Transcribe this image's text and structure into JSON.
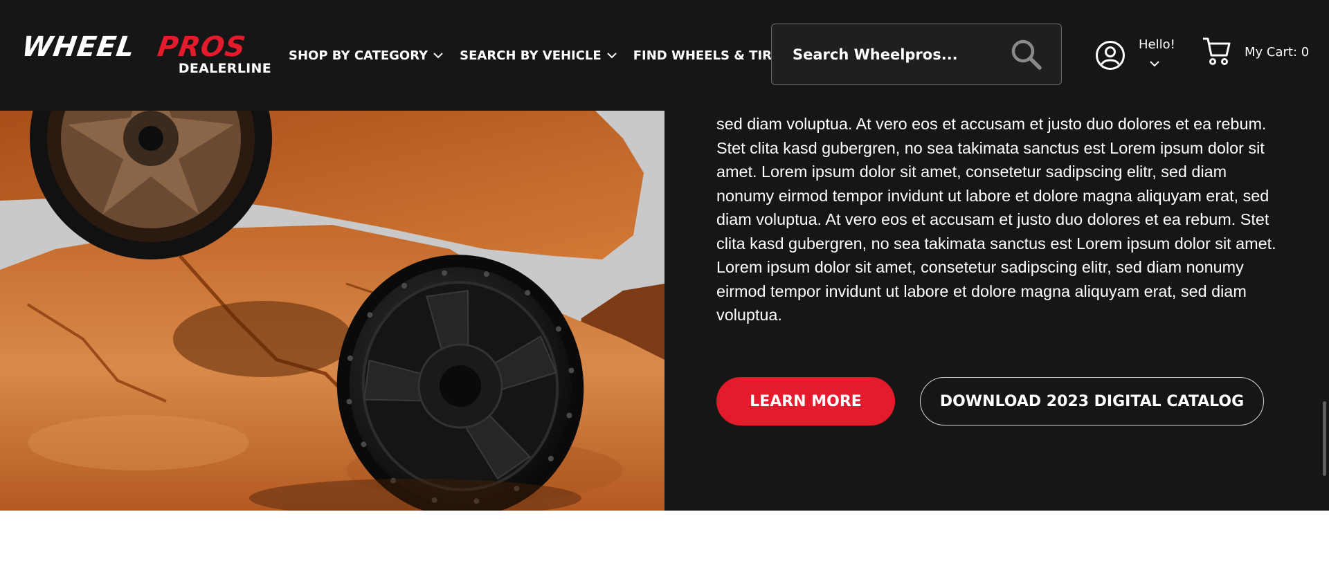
{
  "brand": {
    "word1": "WHEEL",
    "word2": "PROS",
    "sub": "DEALERLINE",
    "accent": "#e31b2c"
  },
  "nav": {
    "items": [
      {
        "label": "SHOP BY CATEGORY",
        "has_dropdown": true
      },
      {
        "label": "SEARCH BY VEHICLE",
        "has_dropdown": true
      },
      {
        "label": "FIND WHEELS & TIRES",
        "has_dropdown": false
      }
    ]
  },
  "search": {
    "placeholder": "Search Wheelpros...",
    "icon": "search-icon"
  },
  "account": {
    "greeting": "Hello!",
    "icon": "user-circle-icon"
  },
  "cart": {
    "label": "My Cart: 0",
    "icon": "shopping-cart-icon"
  },
  "hero": {
    "image_alt": "black off-road wheel on red rock",
    "body": "sed diam voluptua. At vero eos et accusam et justo duo dolores et ea rebum. Stet clita kasd gubergren, no sea takimata sanctus est Lorem ipsum dolor sit amet. Lorem ipsum dolor sit amet, consetetur sadipscing elitr, sed diam nonumy eirmod tempor invidunt ut labore et dolore magna aliquyam erat, sed diam voluptua. At vero eos et accusam et justo duo dolores et ea rebum. Stet clita kasd gubergren, no sea takimata sanctus est Lorem ipsum dolor sit amet. Lorem ipsum dolor sit amet, consetetur sadipscing elitr, sed diam nonumy eirmod tempor invidunt ut labore et dolore magna aliquyam erat, sed diam voluptua.",
    "learn_more": "LEARN MORE",
    "catalog": "DOWNLOAD 2023 DIGITAL CATALOG"
  },
  "colors": {
    "header_bg": "#161616",
    "button_red": "#e31b2c"
  }
}
